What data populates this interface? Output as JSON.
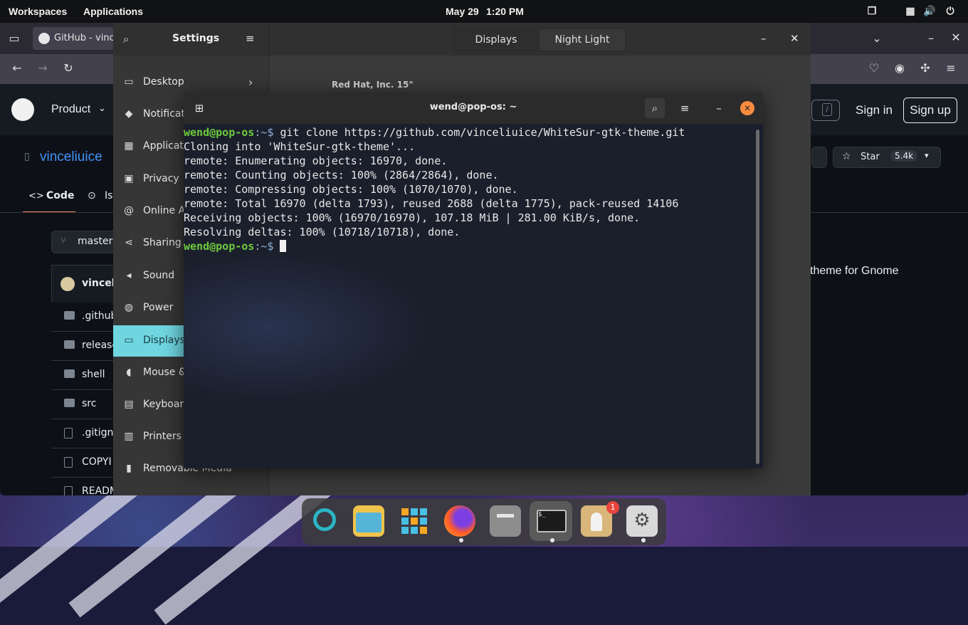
{
  "topbar": {
    "workspaces": "Workspaces",
    "applications": "Applications",
    "date": "May 29",
    "time": "1:20 PM"
  },
  "firefox": {
    "tab_title": "GitHub - vince",
    "github": {
      "product_menu": "Product",
      "sign_in": "Sign in",
      "sign_up": "Sign up",
      "search_key": "/",
      "repo_owner": "vinceliuice",
      "tab_code": "Code",
      "tab_issues": "Is",
      "branch": "master",
      "star_label": "Star",
      "star_count": "5.4k",
      "commit_user": "vinceli",
      "description": "theme for Gnome",
      "files": [
        ".github",
        "release",
        "shell",
        "src",
        ".gitign",
        "COPYI",
        "READM"
      ]
    }
  },
  "settings": {
    "title": "Settings",
    "tabs": [
      "Displays",
      "Night Light"
    ],
    "display_name": "Red Hat, Inc. 15\"",
    "sidebar": [
      {
        "label": "Desktop",
        "icon": "desktop-icon"
      },
      {
        "label": "Notificati",
        "icon": "bell-icon"
      },
      {
        "label": "Applicatio",
        "icon": "grid-icon"
      },
      {
        "label": "Privacy",
        "icon": "hand-icon"
      },
      {
        "label": "Online Ac",
        "icon": "at-icon"
      },
      {
        "label": "Sharing",
        "icon": "share-icon"
      },
      {
        "label": "Sound",
        "icon": "speaker-icon"
      },
      {
        "label": "Power",
        "icon": "power-icon"
      },
      {
        "label": "Displays",
        "icon": "monitor-icon"
      },
      {
        "label": "Mouse &",
        "icon": "mouse-icon"
      },
      {
        "label": "Keyboard",
        "icon": "keyboard-icon"
      },
      {
        "label": "Printers",
        "icon": "printer-icon"
      },
      {
        "label": "Removable Media",
        "icon": "usb-icon"
      }
    ]
  },
  "terminal": {
    "title": "wend@pop-os: ~",
    "user_host": "wend@pop-os",
    "path": ":~$",
    "command": " git clone https://github.com/vinceliuice/WhiteSur-gtk-theme.git",
    "output": [
      "Cloning into 'WhiteSur-gtk-theme'...",
      "remote: Enumerating objects: 16970, done.",
      "remote: Counting objects: 100% (2864/2864), done.",
      "remote: Compressing objects: 100% (1070/1070), done.",
      "remote: Total 16970 (delta 1793), reused 2688 (delta 1775), pack-reused 14106",
      "Receiving objects: 100% (16970/16970), 107.18 MiB | 281.00 KiB/s, done.",
      "Resolving deltas: 100% (10718/10718), done."
    ]
  },
  "dock": {
    "items": [
      "search-app-icon",
      "files-app-icon",
      "app-grid-icon",
      "firefox-icon",
      "file-manager-icon",
      "terminal-icon",
      "pop-shop-icon",
      "settings-icon"
    ],
    "shop_badge": "1"
  }
}
